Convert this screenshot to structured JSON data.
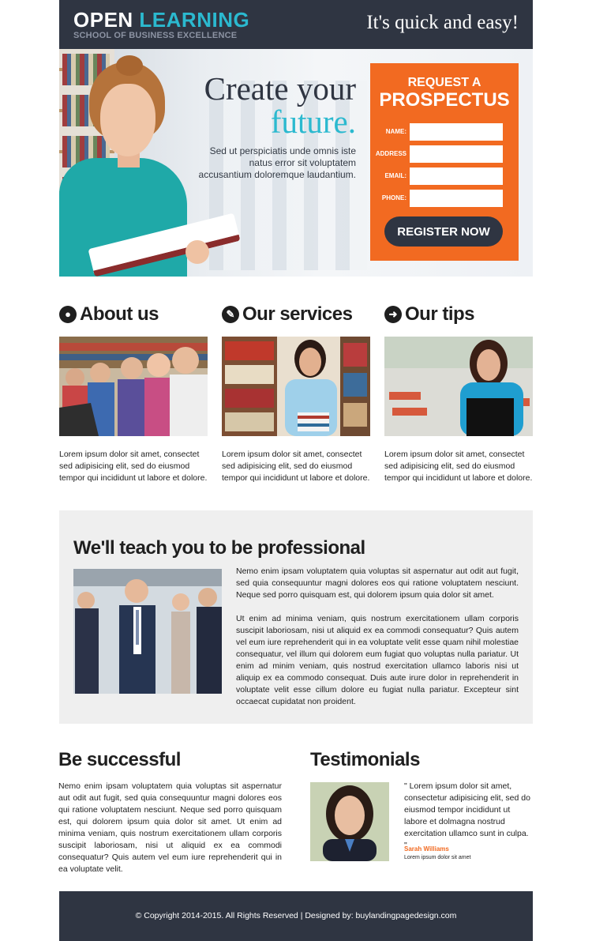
{
  "header": {
    "logo_word1": "OPEN",
    "logo_word2": "LEARNING",
    "logo_subtitle": "SCHOOL OF BUSINESS EXCELLENCE",
    "tagline": "It's quick and easy!"
  },
  "hero": {
    "heading_line1": "Create your",
    "heading_line2": "future.",
    "paragraph": "Sed ut perspiciatis unde omnis iste natus error sit voluptatem accusantium doloremque laudantium."
  },
  "form": {
    "title_line1": "REQUEST A",
    "title_line2": "PROSPECTUS",
    "fields": [
      {
        "label": "NAME:",
        "value": ""
      },
      {
        "label": "ADDRESS",
        "value": ""
      },
      {
        "label": "EMAIL:",
        "value": ""
      },
      {
        "label": "PHONE:",
        "value": ""
      }
    ],
    "submit_label": "REGISTER NOW"
  },
  "features": [
    {
      "title": "About us",
      "icon": "globe-icon",
      "text": "Lorem ipsum dolor sit amet, consectet sed adipisicing elit, sed do eiusmod tempor qui incididunt ut labore et dolore."
    },
    {
      "title": "Our services",
      "icon": "pencil-icon",
      "text": "Lorem ipsum dolor sit amet, consectet sed adipisicing elit, sed do eiusmod tempor qui incididunt ut labore et dolore."
    },
    {
      "title": "Our tips",
      "icon": "arrow-right-icon",
      "text": "Lorem ipsum dolor sit amet, consectet sed adipisicing elit, sed do eiusmod tempor qui incididunt ut labore et dolore."
    }
  ],
  "professional": {
    "title": "We'll teach you to be professional",
    "paragraph1": "Nemo enim ipsam voluptatem quia voluptas sit aspernatur aut odit aut fugit, sed quia consequuntur magni dolores eos qui ratione voluptatem nesciunt. Neque sed porro quisquam est, qui dolorem ipsum quia dolor sit amet.",
    "paragraph2": "Ut enim ad minima veniam, quis nostrum exercitationem ullam corporis suscipit laboriosam, nisi ut aliquid ex ea commodi consequatur? Quis autem vel eum iure reprehenderit qui in ea voluptate velit esse quam nihil molestiae consequatur, vel illum qui dolorem eum fugiat quo voluptas nulla pariatur. Ut enim ad minim veniam, quis nostrud exercitation ullamco laboris nisi ut aliquip ex ea commodo consequat. Duis aute irure dolor in reprehenderit in voluptate velit esse cillum dolore eu fugiat nulla pariatur. Excepteur sint occaecat cupidatat non proident."
  },
  "success": {
    "title": "Be successful",
    "text": "Nemo enim ipsam voluptatem quia voluptas sit aspernatur aut odit aut fugit, sed quia consequuntur magni dolores eos qui ratione voluptatem nesciunt. Neque sed porro quisquam est, qui dolorem ipsum quia dolor sit amet. Ut enim ad minima veniam, quis nostrum exercitationem ullam corporis suscipit laboriosam, nisi ut aliquid ex ea commodi consequatur? Quis autem vel eum iure reprehenderit qui in ea voluptate velit."
  },
  "testimonials": {
    "title": "Testimonials",
    "quote": "\" Lorem ipsum dolor sit amet, consectetur adipisicing elit, sed do eiusmod tempor incididunt ut labore et dolmagna nostrud exercitation ullamco sunt in culpa. \"",
    "name": "Sarah Williams",
    "role": "Lorem ipsum dolor sit amet"
  },
  "footer": {
    "text": "© Copyright 2014-2015. All Rights Reserved  |  Designed by: buylandingpagedesign.com"
  },
  "colors": {
    "dark": "#2f3542",
    "teal": "#2bb9cf",
    "orange": "#f26a21",
    "section_gray": "#efefef"
  }
}
